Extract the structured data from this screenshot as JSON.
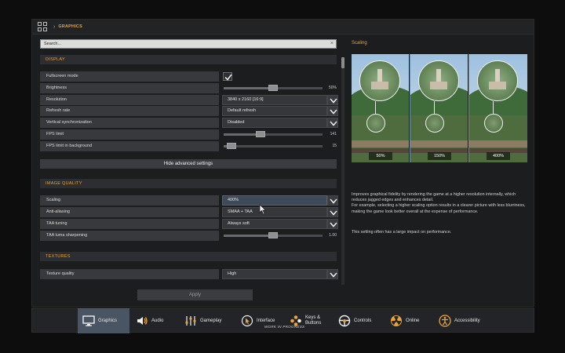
{
  "header": {
    "breadcrumb": "GRAPHICS"
  },
  "search": {
    "placeholder": "Search...",
    "clear": "×"
  },
  "sections": {
    "display": "DISPLAY",
    "image_quality": "IMAGE QUALITY",
    "textures": "TEXTURES"
  },
  "display_rows": {
    "fullscreen": {
      "label": "Fullscreen mode",
      "checked": true
    },
    "brightness": {
      "label": "Brightness",
      "value": "50%",
      "fraction": 0.5
    },
    "resolution": {
      "label": "Resolution",
      "value": "3840 x 2160 [16:9]"
    },
    "refresh": {
      "label": "Refresh rate",
      "value": "Default refresh"
    },
    "vsync": {
      "label": "Vertical synchronization",
      "value": "Disabled"
    },
    "fps": {
      "label": "FPS limit",
      "value": "141",
      "fraction": 0.35
    },
    "fps_bg": {
      "label": "FPS limit in background",
      "value": "15",
      "fraction": 0.05
    }
  },
  "hide_advanced": "Hide advanced settings",
  "image_rows": {
    "scaling": {
      "label": "Scaling",
      "value": "400%"
    },
    "aa": {
      "label": "Anti-aliasing",
      "value": "SMAA + TAA"
    },
    "taa": {
      "label": "TAA tuning",
      "value": "Always soft"
    },
    "sharpen": {
      "label": "TAA luma sharpening",
      "value": "1.00",
      "fraction": 0.5
    }
  },
  "texture_rows": {
    "quality": {
      "label": "Texture quality",
      "value": "High"
    }
  },
  "apply": "Apply",
  "details": {
    "title": "Scaling",
    "preview_labels": [
      "50%",
      "150%",
      "400%"
    ],
    "description": [
      "Improves graphical fidelity by rendering the game at a higher resolution internally, which reduces jagged edges and enhances detail.",
      "For example, selecting a higher scaling option results in a clearer picture with less blurriness, making the game look better overall at the expense of performance."
    ],
    "note": "This setting often has a large impact on performance."
  },
  "tabs": [
    {
      "label": "Graphics",
      "icon": "monitor-icon",
      "active": true
    },
    {
      "label": "Audio",
      "icon": "speaker-icon"
    },
    {
      "label": "Gameplay",
      "icon": "sliders-icon"
    },
    {
      "label": "Interface",
      "icon": "cursor-icon"
    },
    {
      "label": "Keys & Buttons",
      "icon": "gamepad-buttons-icon"
    },
    {
      "label": "Controls",
      "icon": "steering-wheel-icon"
    },
    {
      "label": "Online",
      "icon": "radiation-icon"
    },
    {
      "label": "Accessibility",
      "icon": "accessibility-icon"
    }
  ],
  "wip": "WORK IN PROGRESS",
  "colors": {
    "accent": "#e8a33a",
    "active_tab": "#4a5563"
  }
}
